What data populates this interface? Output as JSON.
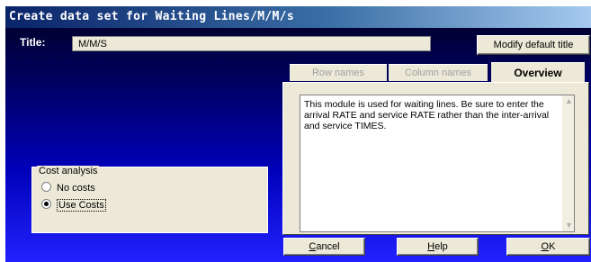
{
  "window": {
    "title": "Create data set for Waiting Lines/M/M/s"
  },
  "title_field": {
    "label": "Title:",
    "value": "M/M/S"
  },
  "buttons": {
    "modify_default_title": "Modify default title",
    "cancel_mnemonic": "C",
    "cancel_rest": "ancel",
    "help_mnemonic": "H",
    "help_rest": "elp",
    "ok_mnemonic": "O",
    "ok_rest": "K"
  },
  "tabs": [
    {
      "label": "Row names",
      "active": false
    },
    {
      "label": "Column names",
      "active": false
    },
    {
      "label": "Overview",
      "active": true
    }
  ],
  "overview": {
    "text": "This module is used for waiting lines. Be sure to enter the arrival RATE and service RATE rather than the inter-arrival and service TIMES."
  },
  "cost_analysis": {
    "legend": "Cost analysis",
    "options": [
      {
        "label": "No costs",
        "selected": false
      },
      {
        "label": "Use Costs",
        "selected": true
      }
    ]
  },
  "colors": {
    "title_bar": "#0a246a",
    "client_bottom": "#2222ff",
    "face": "#ece9d8"
  }
}
